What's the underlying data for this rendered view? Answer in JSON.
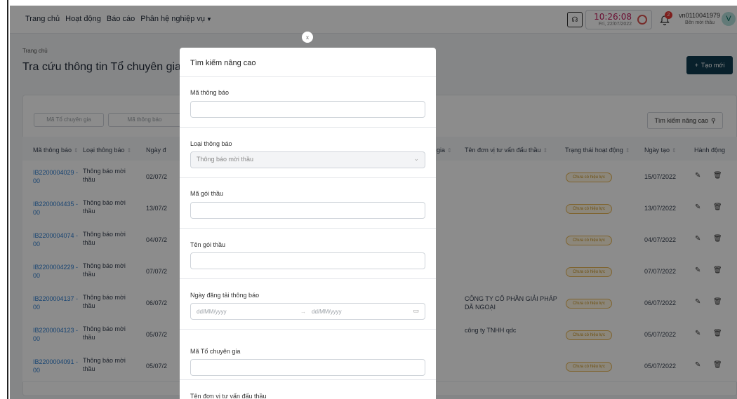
{
  "topbar": {
    "nav": [
      "Trang chủ",
      "Hoạt động",
      "Báo cáo",
      "Phân hệ nghiệp vụ"
    ],
    "time": "10:26:08",
    "date": "Fri, 22/07/2022",
    "notification_count": "2",
    "username": "vn0110041979",
    "role": "Bên mời thầu",
    "avatar_letter": "V"
  },
  "page": {
    "breadcrumb": "Trang chủ",
    "title": "Tra cứu thông tin Tổ chuyên gia",
    "create_button": "Tạo mới"
  },
  "filters": {
    "expert_code_placeholder": "Mã Tổ chuyên gia",
    "notice_code_placeholder": "Mã thông báo",
    "advanced_button": "Tìm kiếm nâng cao"
  },
  "table": {
    "headers": [
      "Mã thông báo",
      "Loại thông báo",
      "Ngày đ",
      "gia",
      "Tên đơn vị tư vấn đấu thầu",
      "Trạng thái hoạt động",
      "Ngày tạo",
      "Hành động"
    ],
    "rows": [
      {
        "code1": "IB2200004029 -",
        "code2": "00",
        "type1": "Thông báo mời",
        "type2": "thầu",
        "date_partial": "02/07/2",
        "consultant1": "",
        "consultant2": "",
        "status": "Chưa có hiệu lực",
        "created": "15/07/2022"
      },
      {
        "code1": "IB2200004435 -",
        "code2": "00",
        "type1": "Thông báo mời",
        "type2": "thầu",
        "date_partial": "13/07/2",
        "consultant1": "",
        "consultant2": "",
        "status": "Chưa có hiệu lực",
        "created": "13/07/2022"
      },
      {
        "code1": "IB2200004074 -",
        "code2": "00",
        "type1": "Thông báo mời",
        "type2": "thầu",
        "date_partial": "04/07/2",
        "consultant1": "",
        "consultant2": "",
        "status": "Chưa có hiệu lực",
        "created": "04/07/2022"
      },
      {
        "code1": "IB2200004229 -",
        "code2": "00",
        "type1": "Thông báo mời",
        "type2": "thầu",
        "date_partial": "07/07/2",
        "consultant1": "",
        "consultant2": "",
        "status": "Chưa có hiệu lực",
        "created": "07/07/2022"
      },
      {
        "code1": "IB2200004137 -",
        "code2": "00",
        "type1": "Thông báo mời",
        "type2": "thầu",
        "date_partial": "06/07/2",
        "consultant1": "CÔNG TY CỔ PHẦN GIẢI PHÁP",
        "consultant2": "DÃ NGOẠI",
        "status": "Chưa có hiệu lực",
        "created": "06/07/2022"
      },
      {
        "code1": "IB2200004123 -",
        "code2": "00",
        "type1": "Thông báo mời",
        "type2": "thầu",
        "date_partial": "05/07/2",
        "consultant1": "công ty TNHH qdc",
        "consultant2": "",
        "status": "Chưa có hiệu lực",
        "created": "05/07/2022"
      },
      {
        "code1": "IB2200004091 -",
        "code2": "00",
        "type1": "Thông báo mời",
        "type2": "thầu",
        "date_partial": "05/07/2",
        "consultant1": "",
        "consultant2": "",
        "status": "Chưa có hiệu lực",
        "created": "05/07/2022"
      }
    ]
  },
  "modal": {
    "close_label": "x",
    "title": "Tìm kiếm nâng cao",
    "fields": {
      "notice_code_label": "Mã thông báo",
      "notice_type_label": "Loại thông báo",
      "notice_type_value": "Thông báo mời thầu",
      "package_code_label": "Mã gói thầu",
      "package_name_label": "Tên gói thầu",
      "post_date_label": "Ngày đăng tải thông báo",
      "date_from_placeholder": "dd/MM/yyyy",
      "date_to_placeholder": "dd/MM/yyyy",
      "expert_code_label": "Mã Tổ chuyên gia",
      "consultant_name_label": "Tên đơn vị tư vấn đấu thầu"
    }
  },
  "colors": {
    "primary_dark": "#103b4f",
    "link": "#2f7fd1",
    "status_border": "#e8b656",
    "clock": "#c2185b"
  }
}
